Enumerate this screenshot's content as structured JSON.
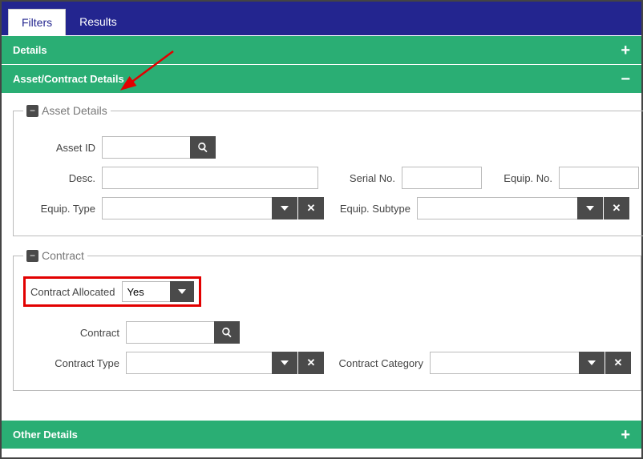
{
  "tabs": {
    "filters": "Filters",
    "results": "Results"
  },
  "panels": {
    "details": {
      "title": "Details",
      "state": "plus"
    },
    "asset_contract": {
      "title": "Asset/Contract Details",
      "state": "minus"
    },
    "other": {
      "title": "Other Details",
      "state": "plus"
    }
  },
  "asset": {
    "legend": "Asset Details",
    "asset_id_label": "Asset ID",
    "asset_id_value": "",
    "desc_label": "Desc.",
    "desc_value": "",
    "serial_label": "Serial No.",
    "serial_value": "",
    "equipno_label": "Equip. No.",
    "equipno_value": "",
    "equip_type_label": "Equip. Type",
    "equip_type_value": "",
    "equip_subtype_label": "Equip. Subtype",
    "equip_subtype_value": ""
  },
  "contract": {
    "legend": "Contract",
    "allocated_label": "Contract Allocated",
    "allocated_value": "Yes",
    "contract_label": "Contract",
    "contract_value": "",
    "type_label": "Contract Type",
    "type_value": "",
    "category_label": "Contract Category",
    "category_value": ""
  },
  "icons": {
    "minus_glyph": "−",
    "plus_glyph": "+"
  }
}
